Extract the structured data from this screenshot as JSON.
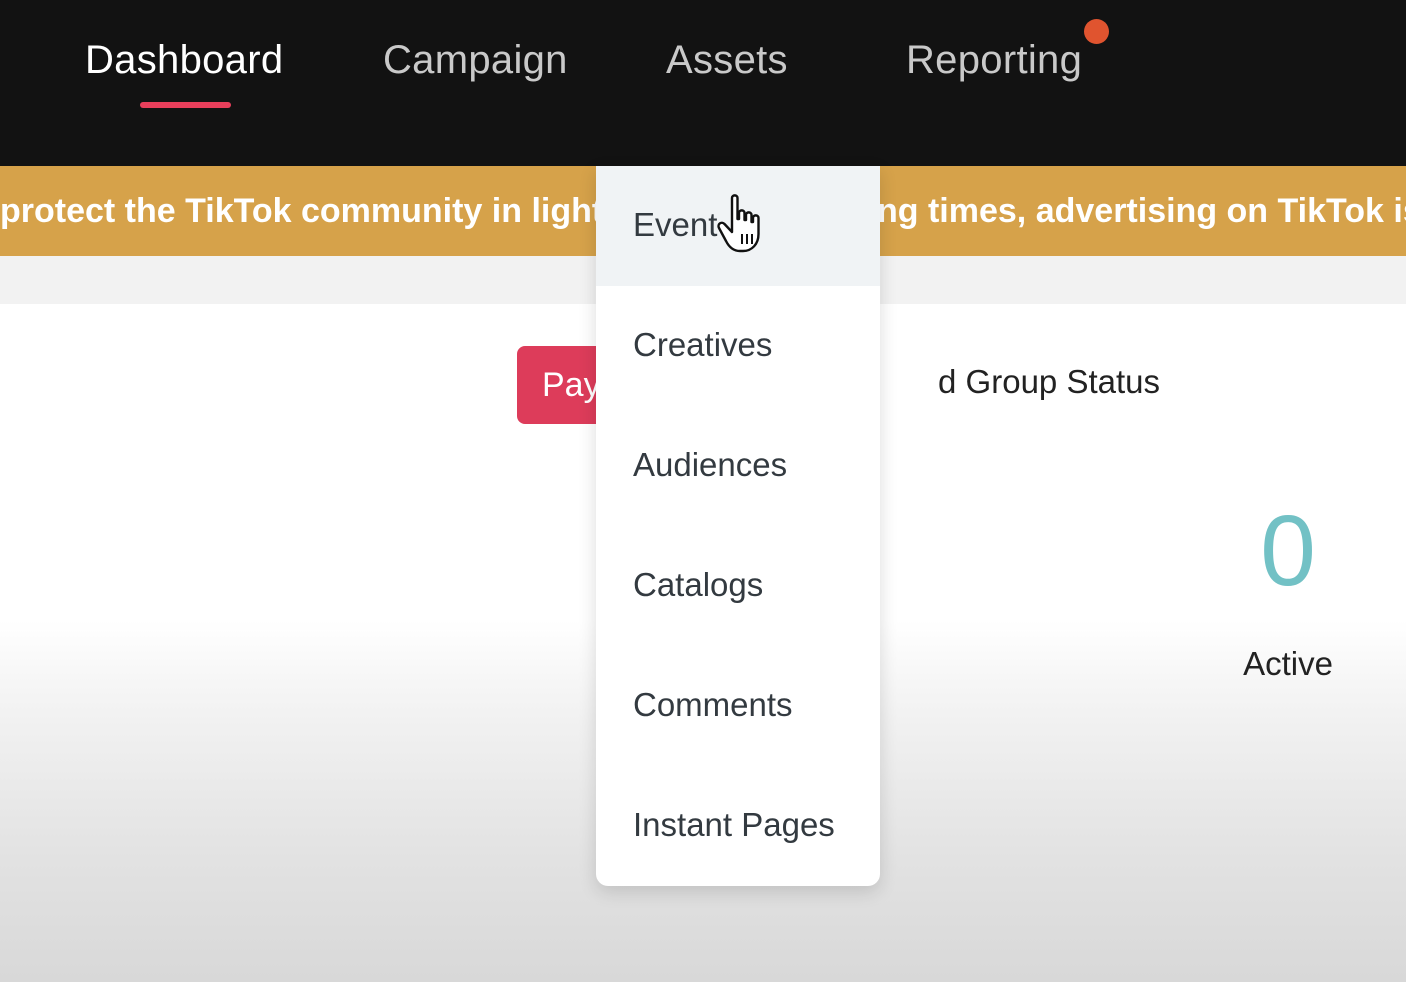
{
  "nav": {
    "items": [
      {
        "label": "Dashboard",
        "active": true
      },
      {
        "label": "Campaign",
        "active": false
      },
      {
        "label": "Assets",
        "active": false
      },
      {
        "label": "Reporting",
        "active": false
      }
    ],
    "notification": {
      "target": "Reporting",
      "color": "#e0542f"
    },
    "accent_color": "#e83f5b"
  },
  "banner": {
    "text_left": "protect the TikTok community in light o",
    "text_right": "ng times, advertising on TikTok is c",
    "background": "#d6a24a"
  },
  "assets_menu": {
    "items": [
      {
        "label": "Event",
        "hovered": true
      },
      {
        "label": "Creatives"
      },
      {
        "label": "Audiences"
      },
      {
        "label": "Catalogs"
      },
      {
        "label": "Comments"
      },
      {
        "label": "Instant Pages"
      }
    ]
  },
  "main": {
    "pay_button_label": "Pay",
    "section_title": "d Group Status",
    "status": {
      "count": "0",
      "label": "Active",
      "count_color": "#72c1c5"
    }
  },
  "cursor": {
    "icon": "hand-pointer-icon"
  }
}
